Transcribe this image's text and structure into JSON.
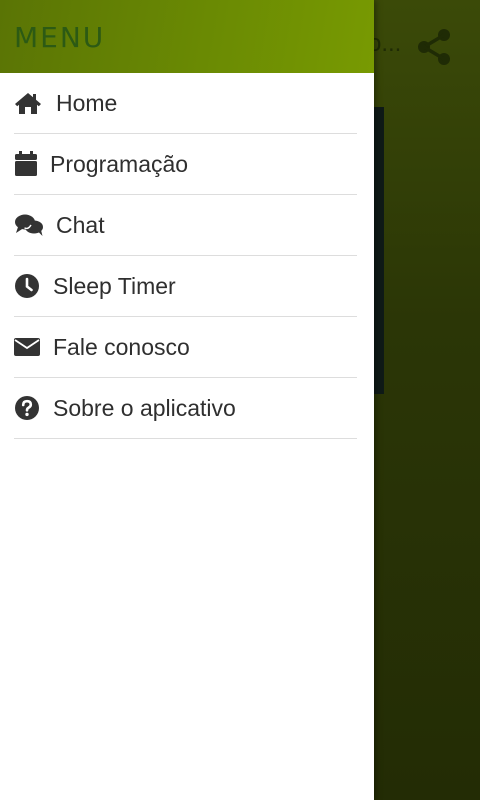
{
  "app": {
    "background_title_visible": "o..."
  },
  "drawer": {
    "title": "MENU",
    "items": [
      {
        "label": "Home",
        "icon": "home-icon"
      },
      {
        "label": "Programação",
        "icon": "calendar-icon"
      },
      {
        "label": "Chat",
        "icon": "chat-icon"
      },
      {
        "label": "Sleep Timer",
        "icon": "clock-icon"
      },
      {
        "label": "Fale conosco",
        "icon": "envelope-icon"
      },
      {
        "label": "Sobre o aplicativo",
        "icon": "question-circle-icon"
      }
    ]
  },
  "colors": {
    "header_green": "#6a8a03",
    "title_green": "#2c5a14",
    "text": "#2f2f2f",
    "divider": "#dddddd"
  }
}
